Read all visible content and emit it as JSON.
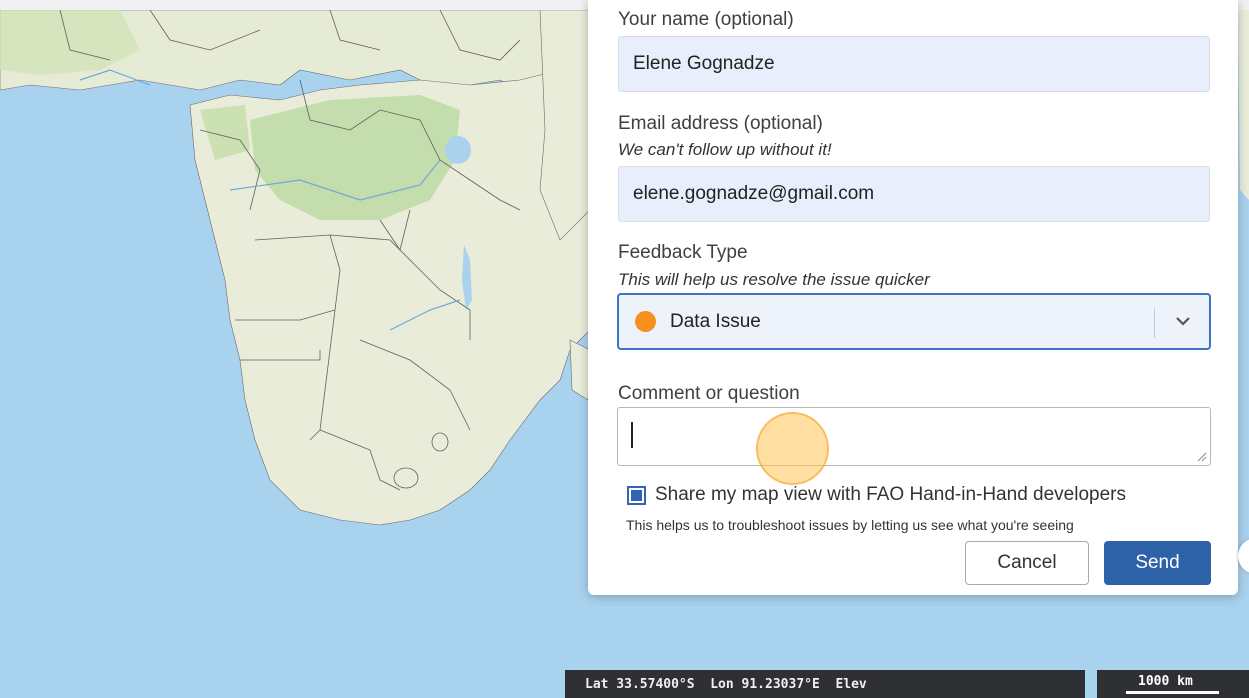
{
  "form": {
    "name_label": "Your name (optional)",
    "name_value": "Elene Gognadze",
    "email_label": "Email address (optional)",
    "email_hint": "We can't follow up without it!",
    "email_value": "elene.gognadze@gmail.com",
    "type_label": "Feedback Type",
    "type_hint": "This will help us resolve the issue quicker",
    "type_selected": "Data Issue",
    "type_dot_color": "#f6901e",
    "comment_label": "Comment or question",
    "comment_value": "",
    "share_label": "Share my map view with FAO Hand-in-Hand developers",
    "share_checked": true,
    "share_hint": "This helps us to troubleshoot issues by letting us see what you're seeing",
    "cancel_label": "Cancel",
    "send_label": "Send"
  },
  "status": {
    "coords_text": "Lat 33.57400°S  Lon 91.23037°E  Elev",
    "scale_label": "1000 km"
  },
  "colors": {
    "ocean": "#a9d2ef",
    "land": "#e8ecd9",
    "forest": "#b9d9a0",
    "accent": "#2e62a8"
  }
}
